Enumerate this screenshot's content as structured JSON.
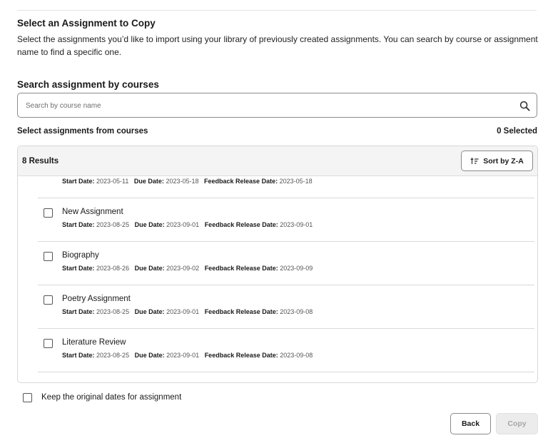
{
  "header": {
    "title": "Select an Assignment to Copy",
    "description": "Select the assignments you’d like to import using your library of previously created assignments. You can search by course or assignment name to find a specific one."
  },
  "search": {
    "heading": "Search assignment by courses",
    "placeholder": "Search by course name",
    "value": "",
    "icon": "search-icon"
  },
  "selection": {
    "heading": "Select assignments from courses",
    "selected_count": "0 Selected"
  },
  "results": {
    "count_label": "8 Results",
    "sort_label": "Sort by Z-A",
    "sort_icon": "sort-descending-icon",
    "partial_item": {
      "start_label": "Start Date:",
      "start": "2023-05-11",
      "due_label": "Due Date:",
      "due": "2023-05-18",
      "release_label": "Feedback Release Date:",
      "release": "2023-05-18"
    },
    "items": [
      {
        "name": "New Assignment",
        "checked": false,
        "start_label": "Start Date:",
        "start": "2023-08-25",
        "due_label": "Due Date:",
        "due": "2023-09-01",
        "release_label": "Feedback Release Date:",
        "release": "2023-09-01"
      },
      {
        "name": "Biography",
        "checked": false,
        "start_label": "Start Date:",
        "start": "2023-08-26",
        "due_label": "Due Date:",
        "due": "2023-09-02",
        "release_label": "Feedback Release Date:",
        "release": "2023-09-09"
      },
      {
        "name": "Poetry Assignment",
        "checked": false,
        "start_label": "Start Date:",
        "start": "2023-08-25",
        "due_label": "Due Date:",
        "due": "2023-09-01",
        "release_label": "Feedback Release Date:",
        "release": "2023-09-08"
      },
      {
        "name": "Literature Review",
        "checked": false,
        "start_label": "Start Date:",
        "start": "2023-08-25",
        "due_label": "Due Date:",
        "due": "2023-09-01",
        "release_label": "Feedback Release Date:",
        "release": "2023-09-08"
      }
    ]
  },
  "options": {
    "keep_dates_label": "Keep the original dates for assignment",
    "keep_dates_checked": false
  },
  "footer": {
    "back_label": "Back",
    "copy_label": "Copy",
    "copy_disabled": true
  }
}
